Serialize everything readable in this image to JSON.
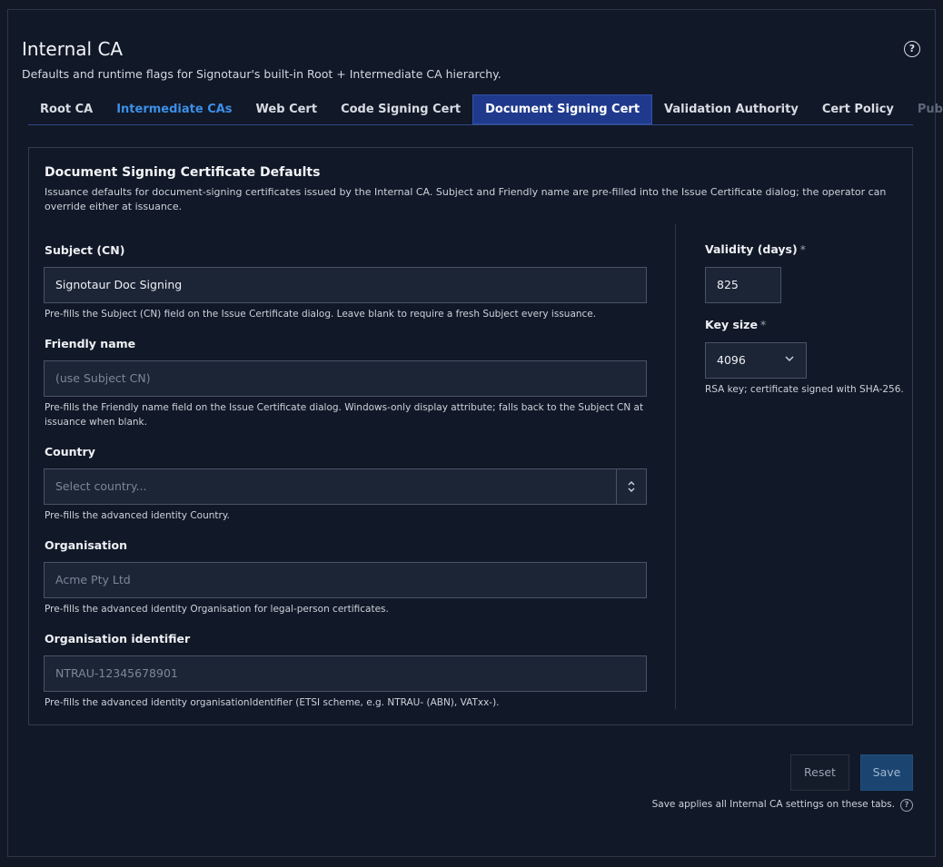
{
  "header": {
    "title": "Internal CA",
    "subtitle": "Defaults and runtime flags for Signotaur's built-in Root + Intermediate CA hierarchy.",
    "help_icon": "?"
  },
  "tabs": [
    {
      "label": "Root CA",
      "state": "normal"
    },
    {
      "label": "Intermediate CAs",
      "state": "link"
    },
    {
      "label": "Web Cert",
      "state": "normal"
    },
    {
      "label": "Code Signing Cert",
      "state": "normal"
    },
    {
      "label": "Document Signing Cert",
      "state": "active"
    },
    {
      "label": "Validation Authority",
      "state": "normal"
    },
    {
      "label": "Cert Policy",
      "state": "normal"
    },
    {
      "label": "Public Dist",
      "state": "disabled"
    }
  ],
  "panel": {
    "title": "Document Signing Certificate Defaults",
    "description": "Issuance defaults for document-signing certificates issued by the Internal CA. Subject and Friendly name are pre-filled into the Issue Certificate dialog; the operator can override either at issuance."
  },
  "fields": {
    "subject": {
      "label": "Subject (CN)",
      "value": "Signotaur Doc Signing",
      "hint": "Pre-fills the Subject (CN) field on the Issue Certificate dialog. Leave blank to require a fresh Subject every issuance."
    },
    "friendly_name": {
      "label": "Friendly name",
      "placeholder": "(use Subject CN)",
      "hint": "Pre-fills the Friendly name field on the Issue Certificate dialog. Windows-only display attribute; falls back to the Subject CN at issuance when blank."
    },
    "country": {
      "label": "Country",
      "placeholder": "Select country...",
      "hint": "Pre-fills the advanced identity Country."
    },
    "organisation": {
      "label": "Organisation",
      "placeholder": "Acme Pty Ltd",
      "hint": "Pre-fills the advanced identity Organisation for legal-person certificates."
    },
    "org_identifier": {
      "label": "Organisation identifier",
      "placeholder": "NTRAU-12345678901",
      "hint": "Pre-fills the advanced identity organisationIdentifier (ETSI scheme, e.g. NTRAU- (ABN), VATxx-)."
    },
    "validity": {
      "label": "Validity (days)",
      "required_mark": "*",
      "value": "825"
    },
    "key_size": {
      "label": "Key size",
      "required_mark": "*",
      "value": "4096",
      "hint": "RSA key; certificate signed with SHA-256."
    }
  },
  "actions": {
    "reset_label": "Reset",
    "save_label": "Save",
    "footer_note": "Save applies all Internal CA settings on these tabs.",
    "help_icon": "?"
  },
  "colors": {
    "background": "#111827",
    "accent_active_tab": "#1f3a8c",
    "link": "#3c8fe6",
    "save_button": "#1b4570"
  }
}
